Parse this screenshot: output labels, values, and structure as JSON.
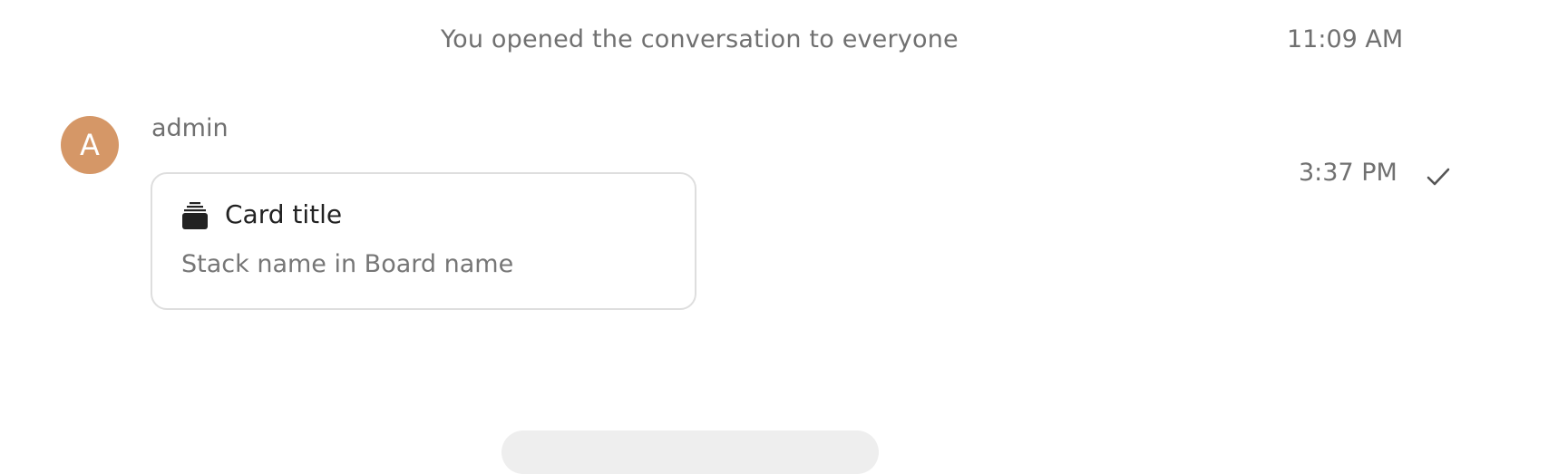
{
  "system_message": {
    "text": "You opened the conversation to everyone",
    "time": "11:09 AM"
  },
  "message": {
    "avatar_initial": "A",
    "avatar_color": "#d59767",
    "author": "admin",
    "time": "3:37 PM",
    "status_icon": "check-icon",
    "card": {
      "icon": "deck-icon",
      "title": "Card title",
      "subtitle": "Stack name in Board name"
    }
  }
}
